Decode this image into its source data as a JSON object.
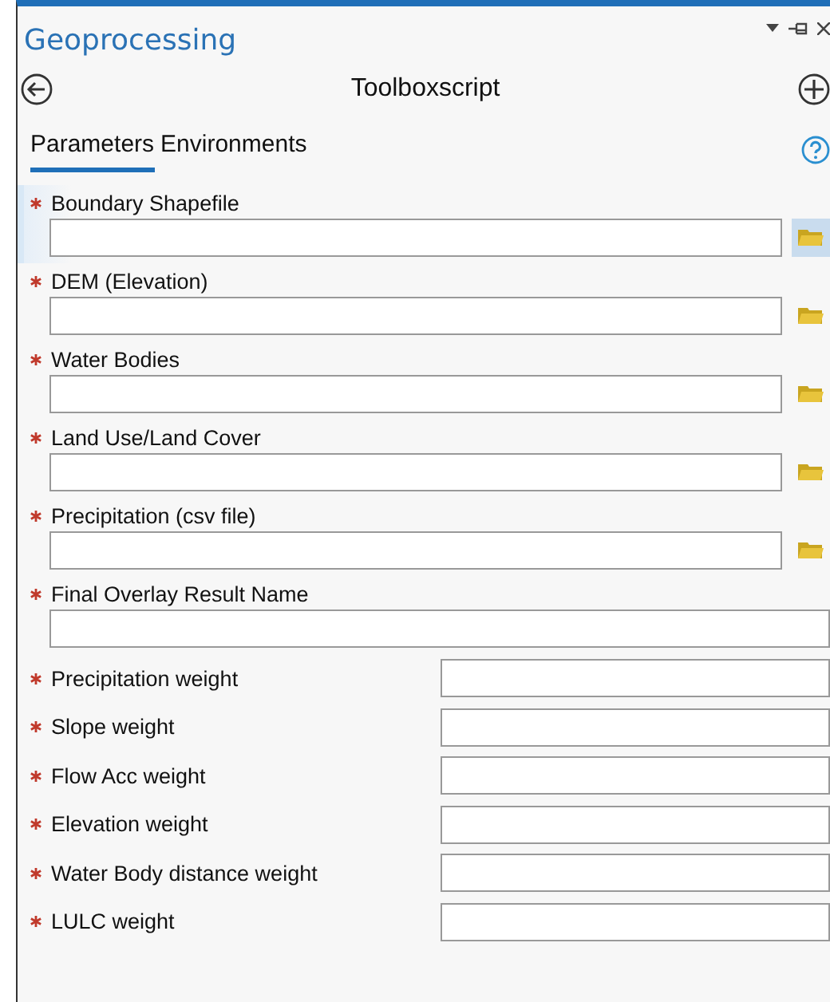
{
  "window": {
    "title": "Geoprocessing"
  },
  "tool": {
    "title": "Toolboxscript"
  },
  "tabs": [
    {
      "label": "Parameters",
      "selected": true
    },
    {
      "label": "Environments",
      "selected": false
    }
  ],
  "parameters": [
    {
      "kind": "file",
      "label": "Boundary Shapefile",
      "required": true,
      "selected": true
    },
    {
      "kind": "file",
      "label": "DEM (Elevation)",
      "required": true,
      "selected": false
    },
    {
      "kind": "file",
      "label": "Water Bodies",
      "required": true,
      "selected": false
    },
    {
      "kind": "file",
      "label": "Land Use/Land Cover",
      "required": true,
      "selected": false
    },
    {
      "kind": "file",
      "label": "Precipitation (csv file)",
      "required": true,
      "selected": false
    },
    {
      "kind": "text",
      "label": "Final Overlay Result Name",
      "required": true,
      "selected": false
    },
    {
      "kind": "weight",
      "label": "Precipitation weight",
      "required": true,
      "selected": false
    },
    {
      "kind": "weight",
      "label": "Slope weight",
      "required": true,
      "selected": false
    },
    {
      "kind": "weight",
      "label": "Flow Acc weight",
      "required": true,
      "selected": false
    },
    {
      "kind": "weight",
      "label": "Elevation weight",
      "required": true,
      "selected": false
    },
    {
      "kind": "weight",
      "label": "Water Body distance weight",
      "required": true,
      "selected": false
    },
    {
      "kind": "weight",
      "label": "LULC weight",
      "required": true,
      "selected": false
    }
  ]
}
